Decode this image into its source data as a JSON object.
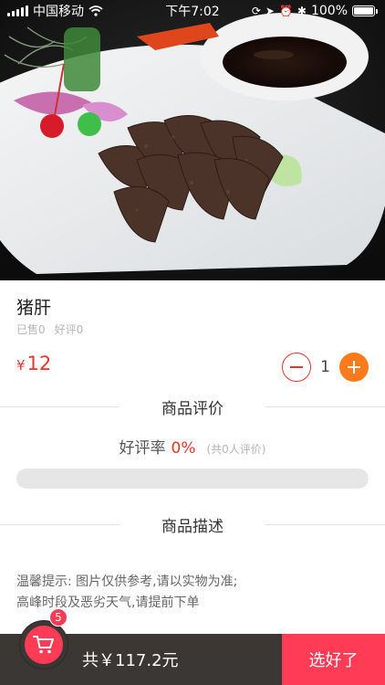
{
  "status_bar": {
    "carrier": "中国移动",
    "time": "下午7:02",
    "battery": "100%"
  },
  "product": {
    "name": "猪肝",
    "sold": "已售0",
    "good_reviews": "好评0",
    "currency": "¥",
    "price": "12",
    "quantity": "1",
    "minus_icon": "minus-circle-icon",
    "plus_icon": "plus-circle-icon"
  },
  "reviews": {
    "title": "商品评价",
    "rate_label": "好评率",
    "rate_value": "0%",
    "count_text": "(共0人评价)",
    "rate_fraction": 0
  },
  "description": {
    "title": "商品描述",
    "line1": "温馨提示: 图片仅供参考,请以实物为准;",
    "line2": "高峰时段及恶劣天气,请提前下单"
  },
  "bottom_bar": {
    "cart_icon": "shopping-cart-icon",
    "cart_badge": "5",
    "total": "共￥117.2元",
    "checkout_label": "选好了"
  },
  "colors": {
    "accent_red": "#e8352c",
    "plus_orange": "#ff7a1a",
    "checkout_pink": "#ff3b55",
    "bottom_bar_bg": "#3a3735"
  }
}
